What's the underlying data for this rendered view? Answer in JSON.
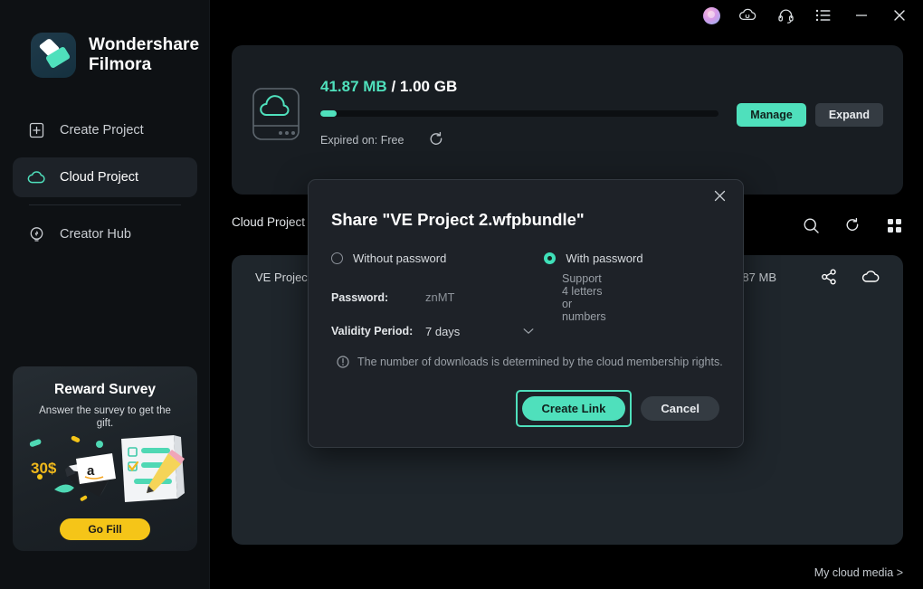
{
  "app": {
    "brand_line1": "Wondershare",
    "brand_line2": "Filmora"
  },
  "titlebar": {
    "icons": [
      {
        "name": "avatar",
        "label": "avatar"
      },
      {
        "name": "cloud-sync-icon",
        "label": "cloud-sync"
      },
      {
        "name": "headset-support-icon",
        "label": "support"
      },
      {
        "name": "list-menu-icon",
        "label": "menu"
      },
      {
        "name": "minimize-icon",
        "label": "minimize"
      },
      {
        "name": "close-icon",
        "label": "close"
      }
    ]
  },
  "sidebar": {
    "items": [
      {
        "label": "Create Project",
        "icon": "file-plus-icon",
        "active": false
      },
      {
        "label": "Cloud Project",
        "icon": "cloud-icon",
        "active": true
      },
      {
        "label": "Creator Hub",
        "icon": "lightbulb-icon",
        "active": false
      }
    ],
    "promo": {
      "title": "Reward Survey",
      "subtitle": "Answer the survey to get the gift.",
      "badge": "30$",
      "button": "Go Fill"
    }
  },
  "storage": {
    "used": "41.87 MB",
    "separator": "/",
    "total": "1.00 GB",
    "percent": 4.1,
    "expiry": "Expired on: Free",
    "manage_label": "Manage",
    "expand_label": "Expand"
  },
  "content": {
    "tab_label": "Cloud Project",
    "tool_icons": [
      "search-icon",
      "refresh-icon",
      "grid-view-icon"
    ],
    "row": {
      "name": "VE Project 2.wfpbundle",
      "size": "41.87 MB",
      "icons": [
        "share-icon",
        "cloud-icon"
      ]
    },
    "cloud_media_link": "My cloud media >"
  },
  "modal": {
    "title": "Share \"VE Project 2.wfpbundle\"",
    "radio_without": "Without password",
    "radio_with": "With password",
    "selected": "with",
    "password_label": "Password:",
    "password_value": "znMT",
    "password_hint": "Support 4 letters or numbers",
    "validity_label": "Validity Period:",
    "validity_value": "7 days",
    "notice": "The number of downloads is determined by the cloud membership rights.",
    "create_label": "Create Link",
    "cancel_label": "Cancel"
  },
  "colors": {
    "accent": "#4fe0bc",
    "sidebar_bg": "#0e1114",
    "panel_bg": "#1f262c",
    "card_bg": "#181d22",
    "modal_bg": "#1e2228",
    "promo_button": "#f5c518"
  }
}
